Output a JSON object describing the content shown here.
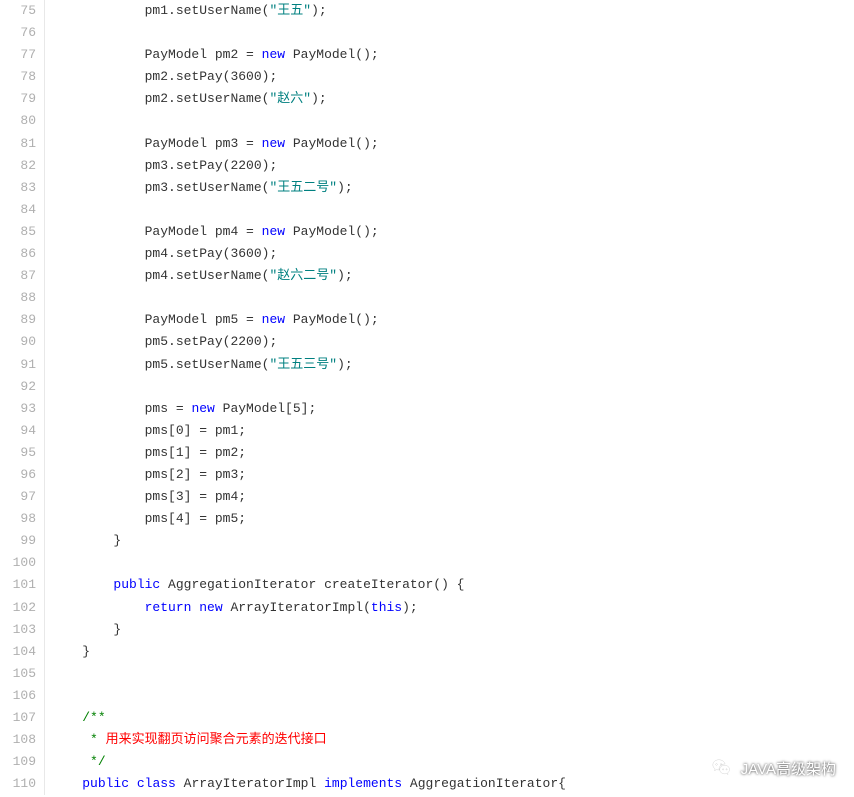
{
  "startLine": 75,
  "lines": [
    {
      "indent": 3,
      "tokens": [
        {
          "t": "pm1.setUserName("
        },
        {
          "t": "\"王五\"",
          "c": "str"
        },
        {
          "t": ");"
        }
      ]
    },
    {
      "indent": 0,
      "tokens": []
    },
    {
      "indent": 3,
      "tokens": [
        {
          "t": "PayModel pm2 = "
        },
        {
          "t": "new",
          "c": "kw"
        },
        {
          "t": " PayModel();"
        }
      ]
    },
    {
      "indent": 3,
      "tokens": [
        {
          "t": "pm2.setPay("
        },
        {
          "t": "3600",
          "c": "num"
        },
        {
          "t": ");"
        }
      ]
    },
    {
      "indent": 3,
      "tokens": [
        {
          "t": "pm2.setUserName("
        },
        {
          "t": "\"赵六\"",
          "c": "str"
        },
        {
          "t": ");"
        }
      ]
    },
    {
      "indent": 0,
      "tokens": []
    },
    {
      "indent": 3,
      "tokens": [
        {
          "t": "PayModel pm3 = "
        },
        {
          "t": "new",
          "c": "kw"
        },
        {
          "t": " PayModel();"
        }
      ]
    },
    {
      "indent": 3,
      "tokens": [
        {
          "t": "pm3.setPay("
        },
        {
          "t": "2200",
          "c": "num"
        },
        {
          "t": ");"
        }
      ]
    },
    {
      "indent": 3,
      "tokens": [
        {
          "t": "pm3.setUserName("
        },
        {
          "t": "\"王五二号\"",
          "c": "str"
        },
        {
          "t": ");"
        }
      ]
    },
    {
      "indent": 0,
      "tokens": []
    },
    {
      "indent": 3,
      "tokens": [
        {
          "t": "PayModel pm4 = "
        },
        {
          "t": "new",
          "c": "kw"
        },
        {
          "t": " PayModel();"
        }
      ]
    },
    {
      "indent": 3,
      "tokens": [
        {
          "t": "pm4.setPay("
        },
        {
          "t": "3600",
          "c": "num"
        },
        {
          "t": ");"
        }
      ]
    },
    {
      "indent": 3,
      "tokens": [
        {
          "t": "pm4.setUserName("
        },
        {
          "t": "\"赵六二号\"",
          "c": "str"
        },
        {
          "t": ");"
        }
      ]
    },
    {
      "indent": 0,
      "tokens": []
    },
    {
      "indent": 3,
      "tokens": [
        {
          "t": "PayModel pm5 = "
        },
        {
          "t": "new",
          "c": "kw"
        },
        {
          "t": " PayModel();"
        }
      ]
    },
    {
      "indent": 3,
      "tokens": [
        {
          "t": "pm5.setPay("
        },
        {
          "t": "2200",
          "c": "num"
        },
        {
          "t": ");"
        }
      ]
    },
    {
      "indent": 3,
      "tokens": [
        {
          "t": "pm5.setUserName("
        },
        {
          "t": "\"王五三号\"",
          "c": "str"
        },
        {
          "t": ");"
        }
      ]
    },
    {
      "indent": 0,
      "tokens": []
    },
    {
      "indent": 3,
      "tokens": [
        {
          "t": "pms = "
        },
        {
          "t": "new",
          "c": "kw"
        },
        {
          "t": " PayModel["
        },
        {
          "t": "5",
          "c": "num"
        },
        {
          "t": "];"
        }
      ]
    },
    {
      "indent": 3,
      "tokens": [
        {
          "t": "pms["
        },
        {
          "t": "0",
          "c": "num"
        },
        {
          "t": "] = pm1;"
        }
      ]
    },
    {
      "indent": 3,
      "tokens": [
        {
          "t": "pms["
        },
        {
          "t": "1",
          "c": "num"
        },
        {
          "t": "] = pm2;"
        }
      ]
    },
    {
      "indent": 3,
      "tokens": [
        {
          "t": "pms["
        },
        {
          "t": "2",
          "c": "num"
        },
        {
          "t": "] = pm3;"
        }
      ]
    },
    {
      "indent": 3,
      "tokens": [
        {
          "t": "pms["
        },
        {
          "t": "3",
          "c": "num"
        },
        {
          "t": "] = pm4;"
        }
      ]
    },
    {
      "indent": 3,
      "tokens": [
        {
          "t": "pms["
        },
        {
          "t": "4",
          "c": "num"
        },
        {
          "t": "] = pm5;"
        }
      ]
    },
    {
      "indent": 2,
      "tokens": [
        {
          "t": "}"
        }
      ]
    },
    {
      "indent": 0,
      "tokens": []
    },
    {
      "indent": 2,
      "tokens": [
        {
          "t": "public",
          "c": "kw"
        },
        {
          "t": " AggregationIterator "
        },
        {
          "t": "createIterator",
          "c": "method"
        },
        {
          "t": "() {"
        }
      ]
    },
    {
      "indent": 3,
      "tokens": [
        {
          "t": "return",
          "c": "kw"
        },
        {
          "t": " "
        },
        {
          "t": "new",
          "c": "kw"
        },
        {
          "t": " ArrayIteratorImpl("
        },
        {
          "t": "this",
          "c": "kw"
        },
        {
          "t": ");"
        }
      ]
    },
    {
      "indent": 2,
      "tokens": [
        {
          "t": "}"
        }
      ]
    },
    {
      "indent": 1,
      "tokens": [
        {
          "t": "}"
        }
      ]
    },
    {
      "indent": 0,
      "tokens": []
    },
    {
      "indent": 0,
      "tokens": []
    },
    {
      "indent": 1,
      "tokens": [
        {
          "t": "/**",
          "c": "comment"
        }
      ]
    },
    {
      "indent": 1,
      "tokens": [
        {
          "t": " * ",
          "c": "comment"
        },
        {
          "t": "用来实现翻页访问聚合元素的迭代接口",
          "c": "comment-red"
        }
      ]
    },
    {
      "indent": 1,
      "tokens": [
        {
          "t": " */",
          "c": "comment"
        }
      ]
    },
    {
      "indent": 1,
      "tokens": [
        {
          "t": "public",
          "c": "kw"
        },
        {
          "t": " "
        },
        {
          "t": "class",
          "c": "kw"
        },
        {
          "t": " ArrayIteratorImpl "
        },
        {
          "t": "implements",
          "c": "kw"
        },
        {
          "t": " AggregationIterator{"
        }
      ]
    }
  ],
  "indentUnit": "    ",
  "watermark": {
    "text": "JAVA高级架构",
    "icon": "wechat-icon"
  }
}
